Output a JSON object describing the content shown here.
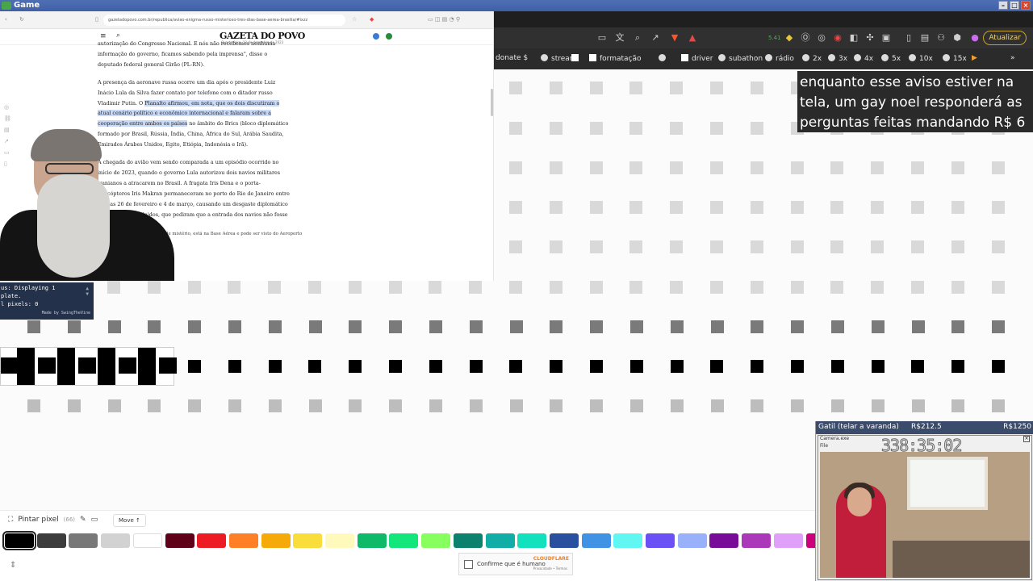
{
  "window": {
    "title": "Game",
    "controls": [
      "minimize",
      "maximize",
      "close"
    ]
  },
  "bg_browser": {
    "update_button": "Atualizar",
    "badge_text": "5.41",
    "bookmarks": [
      "donate $",
      "stream",
      "formatação",
      "driver",
      "subathon",
      "rádio",
      "2x",
      "3x",
      "4x",
      "5x",
      "10x",
      "15x"
    ]
  },
  "article": {
    "url": "gazetadopovo.com.br/republica/aviao-enigma-russo-misterioso-tres-dias-base-aerea-brasilia/#ixzz",
    "logo": "GAZETA DO POVO",
    "date": "Quarta-feira, 13 de dezembro de 2023",
    "paragraphs": [
      "autorização do Congresso Nacional. E nós não recebemos nenhuma informação do governo, ficamos sabendo pela imprensa\", disse o deputado federal general Girão (PL-RN).",
      "A presença da aeronave russa ocorre um dia após o presidente Luiz Inácio Lula da Silva fazer contato por telefone com o ditador russo Vladimir Putin. O",
      "Planalto afirmou, em nota, que os dois discutiram o atual cenário político e econômico internacional e falaram sobre a cooperação entre ambos os países",
      "no âmbito do Brics (bloco diplomático formado por Brasil, Rússia, Índia, China, África do Sul, Arábia Saudita, Emirados Árabes Unidos, Egito, Etiópia, Indonésia e Irã).",
      "A chegada do avião vem sendo comparada a um episódio ocorrido no início de 2023, quando o governo Lula autorizou dois navios militares iranianos a atracarem no Brasil. A fragata Iris Dena e o porta-helicópteros Iris Makran permaneceram no porto do Rio de Janeiro entre os dias 26 de fevereiro e 4 de março, causando um desgaste diplomático com os Estados Unidos, que pediram que a entrada dos navios não fosse autorizada."
    ],
    "caption": "de mistério, está na Base Aérea e pode ser visto do Aeroporto"
  },
  "tts_overlay": {
    "text": "enquanto esse aviso estiver na tela, um gay noel responderá as perguntas feitas mandando R$ 6"
  },
  "status_box": {
    "lines": [
      "us: Displaying 1",
      "plate.",
      "l pixels: 0"
    ],
    "credit": "Made by SwingTheVine"
  },
  "toolbar": {
    "tool_name": "Pintar pixel",
    "pixel_count": "(66)",
    "move_label": "Move ↑",
    "selected_color": "#000000",
    "palette": [
      "#000000",
      "#3c3c3c",
      "#787878",
      "#d2d2d2",
      "#ffffff",
      "#600018",
      "#ed1c24",
      "#ff7f27",
      "#f6aa09",
      "#f9dd3b",
      "#fffabc",
      "#0eb968",
      "#13e67b",
      "#87ff5e",
      "#0c816e",
      "#10aea6",
      "#13e1be",
      "#28509e",
      "#4093e4",
      "#60f7f2",
      "#6b50f6",
      "#99b1fb",
      "#780c99",
      "#aa38b9",
      "#e09ff9",
      "#cb007a"
    ]
  },
  "captcha": {
    "label": "Confirme que é humano",
    "brand": "CLOUDFLARE",
    "links": "Privacidade • Termos"
  },
  "cam2": {
    "header_left": "Gatil (telar a varanda)",
    "header_mid": "R$212.5",
    "header_right": "R$1250",
    "window_title": "Camera.exe",
    "menu": "File",
    "timer": "338:35:02"
  }
}
